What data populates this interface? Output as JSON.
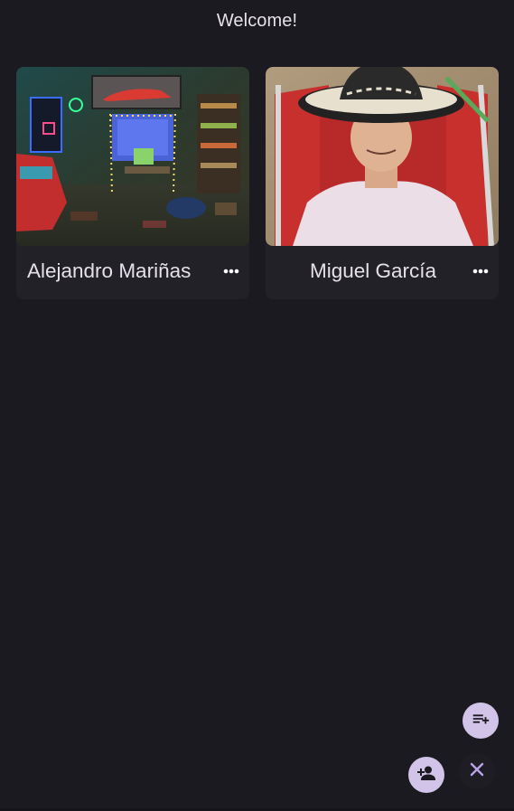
{
  "header": {
    "title": "Welcome!"
  },
  "cards": [
    {
      "name": "Alejandro Mariñas",
      "image_description": "room-thumbnail",
      "more_icon": "more-horizontal-icon"
    },
    {
      "name": "Miguel García",
      "image_description": "person-with-hat-thumbnail",
      "more_icon": "more-horizontal-icon"
    }
  ],
  "fabs": {
    "queue_icon": "playlist-add-icon",
    "add_user_icon": "person-add-icon",
    "close_icon": "close-icon"
  },
  "colors": {
    "background": "#1b1a21",
    "card": "#222128",
    "fab_light": "#d2c4e8",
    "accent": "#b9a2e8",
    "text": "#e6e1e8"
  }
}
